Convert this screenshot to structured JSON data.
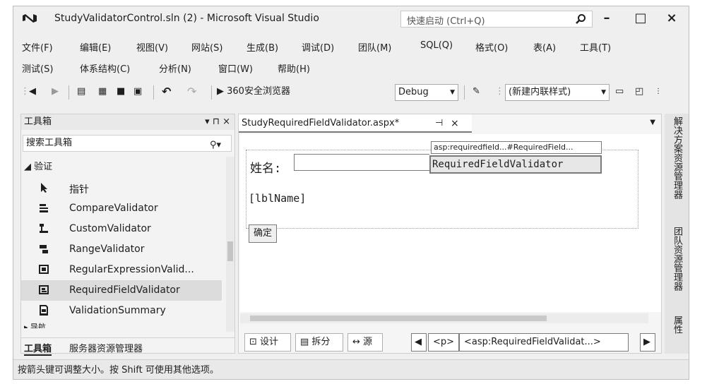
{
  "window": {
    "title": "StudyValidatorControl.sln (2) - Microsoft Visual Studio",
    "quick_launch_placeholder": "快速启动 (Ctrl+Q)",
    "minimize": "–",
    "maximize": "□",
    "close": "×"
  },
  "menu": {
    "row1": [
      "文件(F)",
      "编辑(E)",
      "视图(V)",
      "网站(S)",
      "生成(B)",
      "调试(D)",
      "团队(M)",
      "SQL(Q)",
      "格式(O)",
      "表(A)",
      "工具(T)"
    ],
    "row2": [
      "测试(S)",
      "体系结构(C)",
      "分析(N)",
      "窗口(W)",
      "帮助(H)"
    ]
  },
  "toolbar": {
    "run_label": "▶ 360安全浏览器",
    "config": "Debug",
    "style_combo": "(新建内联样式)"
  },
  "toolbox": {
    "title": "工具箱",
    "pin": "▾ ⊓ ×",
    "search_placeholder": "搜索工具箱",
    "group": "◢ 验证",
    "items": [
      {
        "label": "指针",
        "icon": "pointer-icon"
      },
      {
        "label": "CompareValidator",
        "icon": "compare-validator-icon"
      },
      {
        "label": "CustomValidator",
        "icon": "custom-validator-icon"
      },
      {
        "label": "RangeValidator",
        "icon": "range-validator-icon"
      },
      {
        "label": "RegularExpressionValid...",
        "icon": "regex-validator-icon"
      },
      {
        "label": "RequiredFieldValidator",
        "icon": "required-field-validator-icon"
      },
      {
        "label": "ValidationSummary",
        "icon": "validation-summary-icon"
      }
    ],
    "next_group": "▸ 导航",
    "tabs": [
      "工具箱",
      "服务器资源管理器"
    ]
  },
  "editor": {
    "tab_label": "StudyRequiredFieldValidator.aspx*",
    "tab_pin": "⊣",
    "tab_close": "×",
    "smart_tag": "asp:requiredfield...#RequiredField...",
    "name_label": "姓名:",
    "validator_text": "RequiredFieldValidator",
    "label_control": "[lblName]",
    "ok_button": "确定",
    "views": [
      "设计",
      "拆分",
      "源"
    ],
    "tags": [
      "<p>",
      "<asp:RequiredFieldValidat...>"
    ]
  },
  "side_tabs": [
    "解决方案资源管理器",
    "团队资源管理器",
    "属性"
  ],
  "status": "按箭头键可调整大小。按 Shift 可使用其他选项。"
}
